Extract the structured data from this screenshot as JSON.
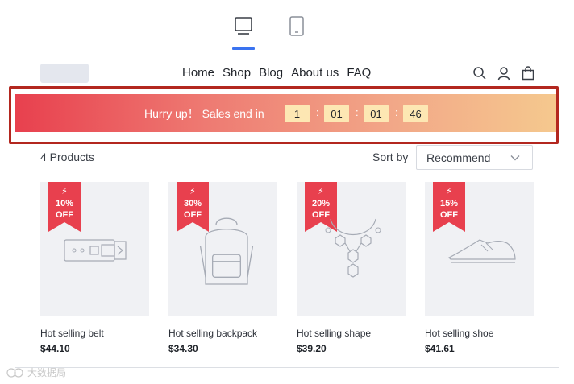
{
  "device_switch": {
    "desktop_icon": "desktop-icon",
    "tablet_icon": "tablet-icon",
    "active": "desktop",
    "accent_color": "#3a73f0"
  },
  "header": {
    "nav": [
      "Home",
      "Shop",
      "Blog",
      "About us",
      "FAQ"
    ],
    "icons": [
      "search-icon",
      "user-icon",
      "shopping-bag-icon"
    ]
  },
  "banner": {
    "text": "Hurry up！ Sales end in",
    "countdown": [
      "1",
      "01",
      "01",
      "46"
    ],
    "separator": ":",
    "gradient_colors": [
      "#e8404e",
      "#f5c98e"
    ],
    "highlight_color": "#b3271f"
  },
  "toolbar": {
    "product_count": "4 Products",
    "sort_label": "Sort by",
    "sort_value": "Recommend"
  },
  "products": [
    {
      "name": "Hot selling belt",
      "price": "$44.10",
      "discount": "10%",
      "off": "OFF",
      "icon": "belt-icon"
    },
    {
      "name": "Hot selling backpack",
      "price": "$34.30",
      "discount": "30%",
      "off": "OFF",
      "icon": "backpack-icon"
    },
    {
      "name": "Hot selling shape",
      "price": "$39.20",
      "discount": "20%",
      "off": "OFF",
      "icon": "necklace-icon"
    },
    {
      "name": "Hot selling shoe",
      "price": "$41.61",
      "discount": "15%",
      "off": "OFF",
      "icon": "shoe-icon"
    }
  ],
  "badge_color": "#e8404e",
  "watermark": {
    "text": "大数据局"
  }
}
